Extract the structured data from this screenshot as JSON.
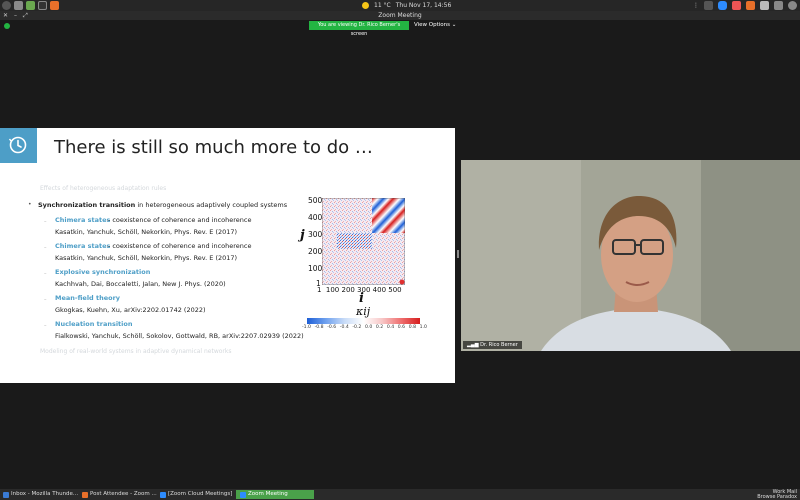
{
  "system_bar": {
    "weather": "11 °C",
    "datetime": "Thu Nov 17, 14:56"
  },
  "zoom": {
    "window_title": "Zoom Meeting",
    "viewing_notice": "You are viewing Dr. Rico Berner's screen",
    "view_options": "View Options",
    "speaker_name": "Dr. Rico Berner"
  },
  "slide": {
    "title": "There is still so much more to do …",
    "faded_top": "Effects of heterogeneous adaptation rules",
    "sync_bold": "Synchronization transition",
    "sync_rest": " in heterogeneous adaptively coupled systems",
    "items": [
      {
        "title": "Chimera states",
        "desc": "– coexistence of coherence and incoherence",
        "ref": "Kasatkin, Yanchuk, Schöll, Nekorkin, Phys. Rev. E (2017)"
      },
      {
        "title": "Chimera states",
        "desc": "– coexistence of coherence and incoherence",
        "ref": "Kasatkin, Yanchuk, Schöll, Nekorkin, Phys. Rev. E (2017)"
      },
      {
        "title": "Explosive synchronization",
        "desc": "",
        "ref": "Kachhvah, Dai, Boccaletti, Jalan, New J. Phys. (2020)"
      },
      {
        "title": "Mean-field theory",
        "desc": "",
        "ref": "Gkogkas, Kuehn, Xu, arXiv:2202.01742 (2022)"
      },
      {
        "title": "Nucleation transition",
        "desc": "",
        "ref": "Fialkowski, Yanchuk, Schöll, Sokolov, Gottwald, RB, arXiv:2207.02939 (2022)"
      }
    ],
    "faded_bottom": "Modeling of real-world systems in adaptive dynamical networks",
    "plot": {
      "y_ticks": [
        "500",
        "400",
        "300",
        "200",
        "100",
        "1"
      ],
      "x_ticks": "1  100 200 300 400 500",
      "x_label": "i",
      "y_label": "j",
      "colorbar_label": "κij",
      "colorbar_ticks": [
        "-1.0",
        "-0.8",
        "-0.6",
        "-0.4",
        "-0.2",
        "0.0",
        "0.2",
        "0.4",
        "0.6",
        "0.8",
        "1.0"
      ]
    }
  },
  "taskbar": {
    "items": [
      "Inbox - Mozilla Thunde...",
      "Post Attendee - Zoom ...",
      "[Zoom Cloud Meetings]",
      "Zoom Meeting"
    ],
    "tray_line1": "Work  Mail",
    "tray_line2": "Browse  Paradox"
  },
  "colors": {
    "accent_blue": "#4d9ec7",
    "viewing_green": "#23b442"
  }
}
